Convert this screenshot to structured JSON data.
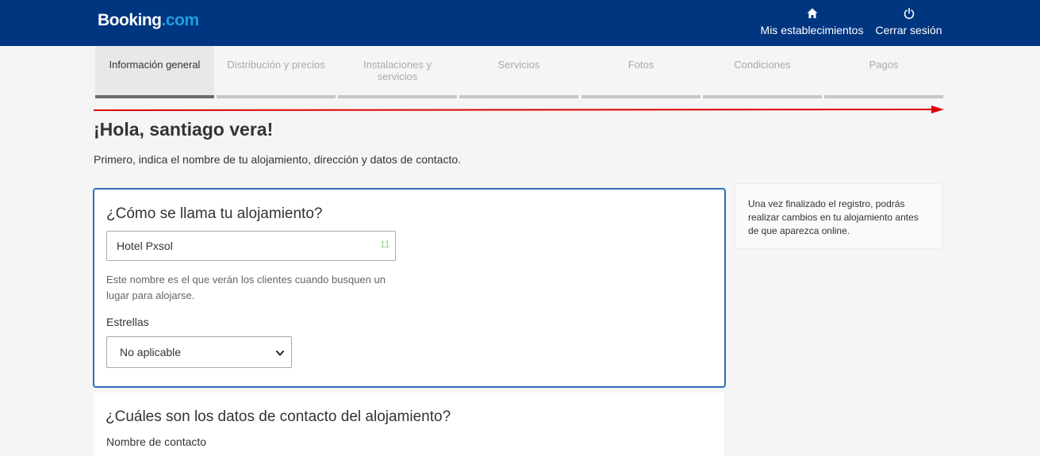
{
  "header": {
    "logo_main": "Booking",
    "logo_suffix": ".com",
    "my_properties": "Mis establecimientos",
    "logout": "Cerrar sesión",
    "icons": {
      "my_properties": "home-icon",
      "logout": "power-icon"
    },
    "colors": {
      "background": "#003580",
      "logo_accent": "#1ba1e2"
    }
  },
  "steps": [
    {
      "label": "Información general",
      "active": true
    },
    {
      "label": "Distribución y precios",
      "active": false
    },
    {
      "label": "Instalaciones y servicios",
      "active": false
    },
    {
      "label": "Servicios",
      "active": false
    },
    {
      "label": "Fotos",
      "active": false
    },
    {
      "label": "Condiciones",
      "active": false
    },
    {
      "label": "Pagos",
      "active": false
    }
  ],
  "greeting": "¡Hola, santiago vera!",
  "intro": "Primero, indica el nombre de tu alojamiento, dirección y datos de contacto.",
  "property_name_card": {
    "title": "¿Cómo se llama tu alojamiento?",
    "input_value": "Hotel Pxsol",
    "char_count": "11",
    "hint": "Este nombre es el que verán los clientes cuando busquen un lugar para alojarse.",
    "stars_label": "Estrellas",
    "stars_value": "No aplicable"
  },
  "contact_card": {
    "title": "¿Cuáles son los datos de contacto del alojamiento?",
    "contact_name_label": "Nombre de contacto"
  },
  "side_note": "Una vez finalizado el registro, podrás realizar cambios en tu alojamiento antes de que aparezca online.",
  "annotation": {
    "arrow_color": "#e00000"
  }
}
